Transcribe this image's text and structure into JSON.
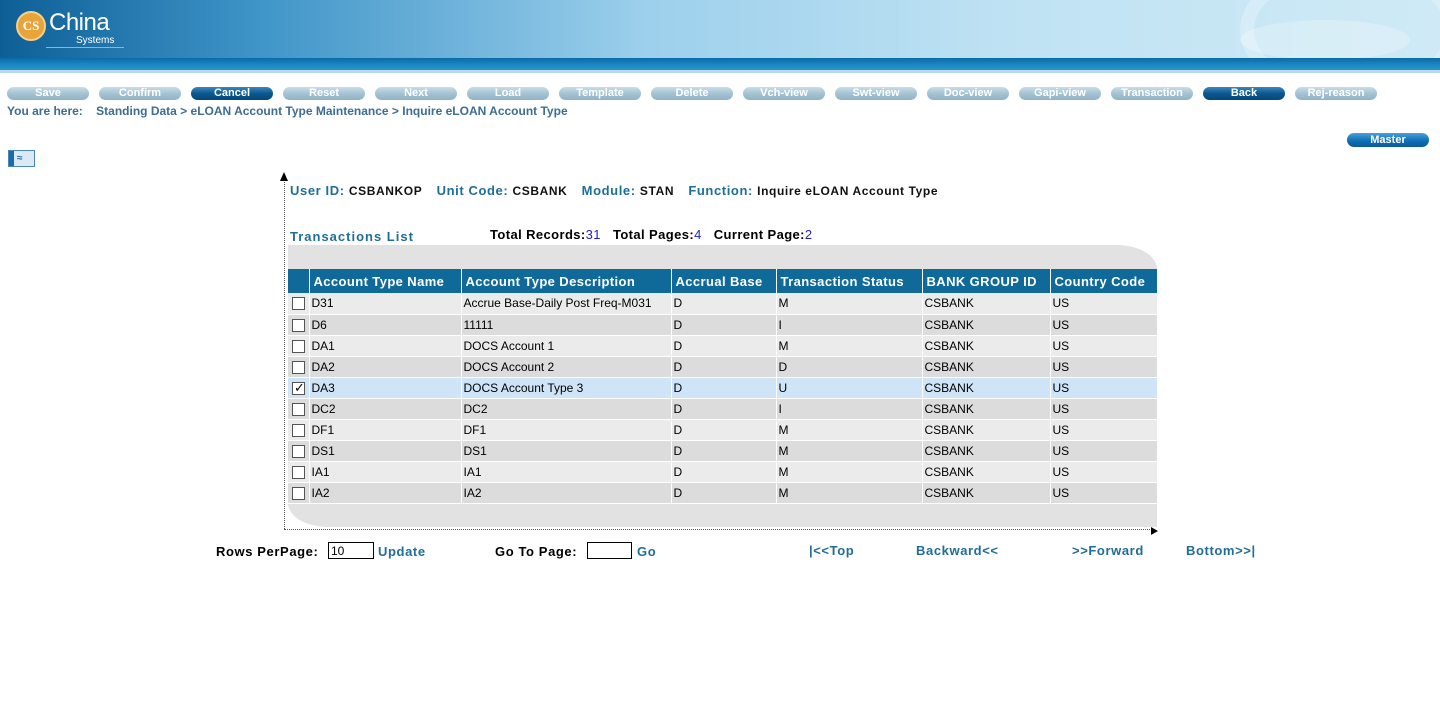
{
  "header": {
    "logo_initials": "CS",
    "logo_name": "China",
    "logo_sub": "Systems"
  },
  "toolbar": {
    "buttons": [
      {
        "label": "Save",
        "active": false
      },
      {
        "label": "Confirm",
        "active": false
      },
      {
        "label": "Cancel",
        "active": true
      },
      {
        "label": "Reset",
        "active": false
      },
      {
        "label": "Next",
        "active": false
      },
      {
        "label": "Load",
        "active": false
      },
      {
        "label": "Template",
        "active": false
      },
      {
        "label": "Delete",
        "active": false
      },
      {
        "label": "Vch-view",
        "active": false
      },
      {
        "label": "Swt-view",
        "active": false
      },
      {
        "label": "Doc-view",
        "active": false
      },
      {
        "label": "Gapi-view",
        "active": false
      },
      {
        "label": "Transaction",
        "active": false
      },
      {
        "label": "Back",
        "active": true
      },
      {
        "label": "Rej-reason",
        "active": false
      }
    ]
  },
  "breadcrumb": {
    "prefix": "You are here:",
    "items": [
      "Standing Data",
      "eLOAN Account Type Maintenance",
      "Inquire eLOAN Account Type"
    ],
    "separator": ">"
  },
  "master_button": "Master",
  "collapse_glyph": "≈",
  "info": {
    "user_id_label": "User ID:",
    "user_id": "CSBANKOP",
    "unit_code_label": "Unit Code:",
    "unit_code": "CSBANK",
    "module_label": "Module:",
    "module": "STAN",
    "function_label": "Function:",
    "function": "Inquire eLOAN Account Type"
  },
  "list": {
    "title": "Transactions List",
    "total_records_label": "Total Records:",
    "total_records": "31",
    "total_pages_label": "Total Pages:",
    "total_pages": "4",
    "current_page_label": "Current Page:",
    "current_page": "2"
  },
  "table": {
    "columns": [
      "Account Type Name",
      "Account Type Description",
      "Accrual Base",
      "Transaction Status",
      "BANK GROUP ID",
      "Country Code"
    ],
    "rows": [
      {
        "checked": false,
        "cells": [
          "D31",
          "Accrue Base-Daily Post Freq-M031",
          "D",
          "M",
          "CSBANK",
          "US"
        ]
      },
      {
        "checked": false,
        "cells": [
          "D6",
          "11111",
          "D",
          "I",
          "CSBANK",
          "US"
        ]
      },
      {
        "checked": false,
        "cells": [
          "DA1",
          "DOCS Account 1",
          "D",
          "M",
          "CSBANK",
          "US"
        ]
      },
      {
        "checked": false,
        "cells": [
          "DA2",
          "DOCS Account 2",
          "D",
          "D",
          "CSBANK",
          "US"
        ]
      },
      {
        "checked": true,
        "cells": [
          "DA3",
          "DOCS Account Type 3",
          "D",
          "U",
          "CSBANK",
          "US"
        ]
      },
      {
        "checked": false,
        "cells": [
          "DC2",
          "DC2",
          "D",
          "I",
          "CSBANK",
          "US"
        ]
      },
      {
        "checked": false,
        "cells": [
          "DF1",
          "DF1",
          "D",
          "M",
          "CSBANK",
          "US"
        ]
      },
      {
        "checked": false,
        "cells": [
          "DS1",
          "DS1",
          "D",
          "M",
          "CSBANK",
          "US"
        ]
      },
      {
        "checked": false,
        "cells": [
          "IA1",
          "IA1",
          "D",
          "M",
          "CSBANK",
          "US"
        ]
      },
      {
        "checked": false,
        "cells": [
          "IA2",
          "IA2",
          "D",
          "M",
          "CSBANK",
          "US"
        ]
      }
    ]
  },
  "pager": {
    "rows_per_page_label": "Rows PerPage:",
    "rows_per_page": "10",
    "update": "Update",
    "goto_label": "Go To Page:",
    "goto_value": "",
    "go": "Go",
    "top": "|<<Top",
    "backward": "Backward<<",
    "forward": ">>Forward",
    "bottom": "Bottom>>|"
  }
}
